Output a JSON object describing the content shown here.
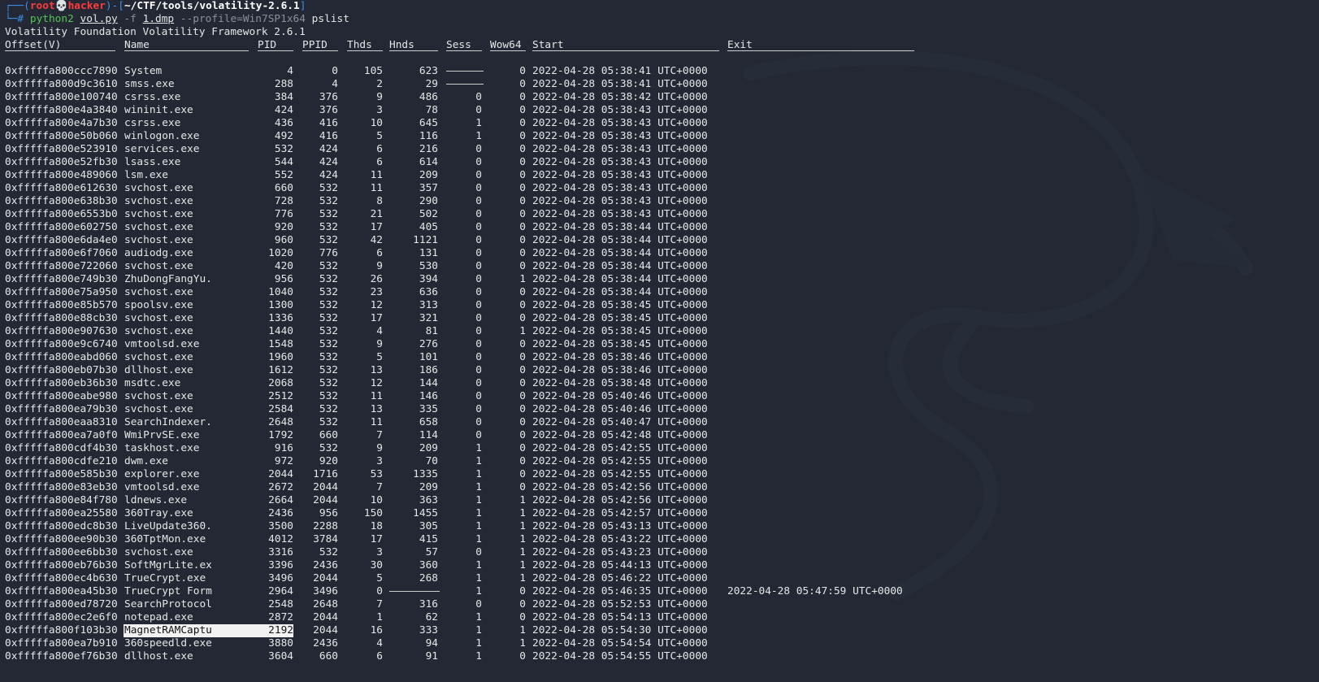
{
  "prompt": {
    "user": "root",
    "skull": "💀",
    "host": "hacker",
    "cwd": "~/CTF/tools/volatility-2.6.1",
    "cmd_python": "python2",
    "cmd_script": "vol.py",
    "cmd_f": "-f",
    "cmd_file": "1.dmp",
    "cmd_profile": "--profile=Win7SP1x64",
    "cmd_plugin": "pslist"
  },
  "banner": "Volatility Foundation Volatility Framework 2.6.1",
  "headers": [
    "Offset(V)",
    "Name",
    "PID",
    "PPID",
    "Thds",
    "Hnds",
    "Sess",
    "Wow64",
    "Start",
    "Exit"
  ],
  "rows": [
    [
      "0xfffffa800ccc7890",
      "System",
      "4",
      "0",
      "105",
      "623",
      "------",
      "0",
      "2022-04-28 05:38:41 UTC+0000",
      ""
    ],
    [
      "0xfffffa800d9c3610",
      "smss.exe",
      "288",
      "4",
      "2",
      "29",
      "------",
      "0",
      "2022-04-28 05:38:41 UTC+0000",
      ""
    ],
    [
      "0xfffffa800e100740",
      "csrss.exe",
      "384",
      "376",
      "9",
      "486",
      "0",
      "0",
      "2022-04-28 05:38:42 UTC+0000",
      ""
    ],
    [
      "0xfffffa800e4a3840",
      "wininit.exe",
      "424",
      "376",
      "3",
      "78",
      "0",
      "0",
      "2022-04-28 05:38:43 UTC+0000",
      ""
    ],
    [
      "0xfffffa800e4a7b30",
      "csrss.exe",
      "436",
      "416",
      "10",
      "645",
      "1",
      "0",
      "2022-04-28 05:38:43 UTC+0000",
      ""
    ],
    [
      "0xfffffa800e50b060",
      "winlogon.exe",
      "492",
      "416",
      "5",
      "116",
      "1",
      "0",
      "2022-04-28 05:38:43 UTC+0000",
      ""
    ],
    [
      "0xfffffa800e523910",
      "services.exe",
      "532",
      "424",
      "6",
      "216",
      "0",
      "0",
      "2022-04-28 05:38:43 UTC+0000",
      ""
    ],
    [
      "0xfffffa800e52fb30",
      "lsass.exe",
      "544",
      "424",
      "6",
      "614",
      "0",
      "0",
      "2022-04-28 05:38:43 UTC+0000",
      ""
    ],
    [
      "0xfffffa800e489060",
      "lsm.exe",
      "552",
      "424",
      "11",
      "209",
      "0",
      "0",
      "2022-04-28 05:38:43 UTC+0000",
      ""
    ],
    [
      "0xfffffa800e612630",
      "svchost.exe",
      "660",
      "532",
      "11",
      "357",
      "0",
      "0",
      "2022-04-28 05:38:43 UTC+0000",
      ""
    ],
    [
      "0xfffffa800e638b30",
      "svchost.exe",
      "728",
      "532",
      "8",
      "290",
      "0",
      "0",
      "2022-04-28 05:38:43 UTC+0000",
      ""
    ],
    [
      "0xfffffa800e6553b0",
      "svchost.exe",
      "776",
      "532",
      "21",
      "502",
      "0",
      "0",
      "2022-04-28 05:38:43 UTC+0000",
      ""
    ],
    [
      "0xfffffa800e602750",
      "svchost.exe",
      "920",
      "532",
      "17",
      "405",
      "0",
      "0",
      "2022-04-28 05:38:44 UTC+0000",
      ""
    ],
    [
      "0xfffffa800e6da4e0",
      "svchost.exe",
      "960",
      "532",
      "42",
      "1121",
      "0",
      "0",
      "2022-04-28 05:38:44 UTC+0000",
      ""
    ],
    [
      "0xfffffa800e6f7060",
      "audiodg.exe",
      "1020",
      "776",
      "6",
      "131",
      "0",
      "0",
      "2022-04-28 05:38:44 UTC+0000",
      ""
    ],
    [
      "0xfffffa800e722060",
      "svchost.exe",
      "420",
      "532",
      "9",
      "530",
      "0",
      "0",
      "2022-04-28 05:38:44 UTC+0000",
      ""
    ],
    [
      "0xfffffa800e749b30",
      "ZhuDongFangYu.",
      "956",
      "532",
      "26",
      "394",
      "0",
      "1",
      "2022-04-28 05:38:44 UTC+0000",
      ""
    ],
    [
      "0xfffffa800e75a950",
      "svchost.exe",
      "1040",
      "532",
      "23",
      "636",
      "0",
      "0",
      "2022-04-28 05:38:44 UTC+0000",
      ""
    ],
    [
      "0xfffffa800e85b570",
      "spoolsv.exe",
      "1300",
      "532",
      "12",
      "313",
      "0",
      "0",
      "2022-04-28 05:38:45 UTC+0000",
      ""
    ],
    [
      "0xfffffa800e88cb30",
      "svchost.exe",
      "1336",
      "532",
      "17",
      "321",
      "0",
      "0",
      "2022-04-28 05:38:45 UTC+0000",
      ""
    ],
    [
      "0xfffffa800e907630",
      "svchost.exe",
      "1440",
      "532",
      "4",
      "81",
      "0",
      "1",
      "2022-04-28 05:38:45 UTC+0000",
      ""
    ],
    [
      "0xfffffa800e9c6740",
      "vmtoolsd.exe",
      "1548",
      "532",
      "9",
      "276",
      "0",
      "0",
      "2022-04-28 05:38:45 UTC+0000",
      ""
    ],
    [
      "0xfffffa800eabd060",
      "svchost.exe",
      "1960",
      "532",
      "5",
      "101",
      "0",
      "0",
      "2022-04-28 05:38:46 UTC+0000",
      ""
    ],
    [
      "0xfffffa800eb07b30",
      "dllhost.exe",
      "1612",
      "532",
      "13",
      "186",
      "0",
      "0",
      "2022-04-28 05:38:46 UTC+0000",
      ""
    ],
    [
      "0xfffffa800eb36b30",
      "msdtc.exe",
      "2068",
      "532",
      "12",
      "144",
      "0",
      "0",
      "2022-04-28 05:38:48 UTC+0000",
      ""
    ],
    [
      "0xfffffa800eabe980",
      "svchost.exe",
      "2512",
      "532",
      "11",
      "146",
      "0",
      "0",
      "2022-04-28 05:40:46 UTC+0000",
      ""
    ],
    [
      "0xfffffa800ea79b30",
      "svchost.exe",
      "2584",
      "532",
      "13",
      "335",
      "0",
      "0",
      "2022-04-28 05:40:46 UTC+0000",
      ""
    ],
    [
      "0xfffffa800eaa8310",
      "SearchIndexer.",
      "2648",
      "532",
      "11",
      "658",
      "0",
      "0",
      "2022-04-28 05:40:47 UTC+0000",
      ""
    ],
    [
      "0xfffffa800ea7a0f0",
      "WmiPrvSE.exe",
      "1792",
      "660",
      "7",
      "114",
      "0",
      "0",
      "2022-04-28 05:42:48 UTC+0000",
      ""
    ],
    [
      "0xfffffa800cdf4b30",
      "taskhost.exe",
      "916",
      "532",
      "9",
      "209",
      "1",
      "0",
      "2022-04-28 05:42:55 UTC+0000",
      ""
    ],
    [
      "0xfffffa800cdfe210",
      "dwm.exe",
      "972",
      "920",
      "3",
      "70",
      "1",
      "0",
      "2022-04-28 05:42:55 UTC+0000",
      ""
    ],
    [
      "0xfffffa800e585b30",
      "explorer.exe",
      "2044",
      "1716",
      "53",
      "1335",
      "1",
      "0",
      "2022-04-28 05:42:55 UTC+0000",
      ""
    ],
    [
      "0xfffffa800e83eb30",
      "vmtoolsd.exe",
      "2672",
      "2044",
      "7",
      "209",
      "1",
      "0",
      "2022-04-28 05:42:56 UTC+0000",
      ""
    ],
    [
      "0xfffffa800e84f780",
      "ldnews.exe",
      "2664",
      "2044",
      "10",
      "363",
      "1",
      "1",
      "2022-04-28 05:42:56 UTC+0000",
      ""
    ],
    [
      "0xfffffa800ea25580",
      "360Tray.exe",
      "2436",
      "956",
      "150",
      "1455",
      "1",
      "1",
      "2022-04-28 05:42:57 UTC+0000",
      ""
    ],
    [
      "0xfffffa800edc8b30",
      "LiveUpdate360.",
      "3500",
      "2288",
      "18",
      "305",
      "1",
      "1",
      "2022-04-28 05:43:13 UTC+0000",
      ""
    ],
    [
      "0xfffffa800ee90b30",
      "360TptMon.exe",
      "4012",
      "3784",
      "17",
      "415",
      "1",
      "1",
      "2022-04-28 05:43:22 UTC+0000",
      ""
    ],
    [
      "0xfffffa800ee6bb30",
      "svchost.exe",
      "3316",
      "532",
      "3",
      "57",
      "0",
      "1",
      "2022-04-28 05:43:23 UTC+0000",
      ""
    ],
    [
      "0xfffffa800eb76b30",
      "SoftMgrLite.ex",
      "3396",
      "2436",
      "30",
      "360",
      "1",
      "1",
      "2022-04-28 05:44:13 UTC+0000",
      ""
    ],
    [
      "0xfffffa800ec4b630",
      "TrueCrypt.exe",
      "3496",
      "2044",
      "5",
      "268",
      "1",
      "1",
      "2022-04-28 05:46:22 UTC+0000",
      ""
    ],
    [
      "0xfffffa800ea45b30",
      "TrueCrypt Form",
      "2964",
      "3496",
      "0",
      "--------",
      "1",
      "0",
      "2022-04-28 05:46:35 UTC+0000",
      "2022-04-28 05:47:59 UTC+0000"
    ],
    [
      "0xfffffa800ed78720",
      "SearchProtocol",
      "2548",
      "2648",
      "7",
      "316",
      "0",
      "0",
      "2022-04-28 05:52:53 UTC+0000",
      ""
    ],
    [
      "0xfffffa800ec2e6f0",
      "notepad.exe",
      "2872",
      "2044",
      "1",
      "62",
      "1",
      "0",
      "2022-04-28 05:54:13 UTC+0000",
      ""
    ],
    [
      "0xfffffa800f103b30",
      "MagnetRAMCaptu",
      "2192",
      "2044",
      "16",
      "333",
      "1",
      "1",
      "2022-04-28 05:54:30 UTC+0000",
      ""
    ],
    [
      "0xfffffa800ea7b910",
      "360speedld.exe",
      "3880",
      "2436",
      "4",
      "94",
      "1",
      "1",
      "2022-04-28 05:54:54 UTC+0000",
      ""
    ],
    [
      "0xfffffa800ef76b30",
      "dllhost.exe",
      "3604",
      "660",
      "6",
      "91",
      "1",
      "0",
      "2022-04-28 05:54:55 UTC+0000",
      ""
    ]
  ],
  "highlighted_row": 43
}
